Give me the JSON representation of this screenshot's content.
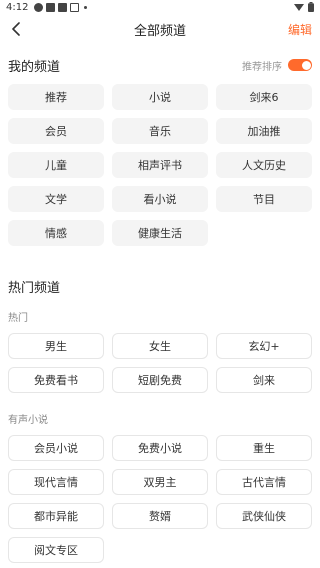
{
  "status": {
    "time": "4:12"
  },
  "header": {
    "title": "全部频道",
    "edit": "编辑"
  },
  "my_channels": {
    "title": "我的频道",
    "sort_label": "推荐排序",
    "sort_enabled": true,
    "items": [
      "推荐",
      "小说",
      "剑来6",
      "会员",
      "音乐",
      "加油推",
      "儿童",
      "相声评书",
      "人文历史",
      "文学",
      "看小说",
      "节目",
      "情感",
      "健康生活"
    ]
  },
  "hot_channels": {
    "title": "热门频道",
    "groups": [
      {
        "name": "热门",
        "items": [
          "男生",
          "女生",
          "玄幻+",
          "免费看书",
          "短剧免费",
          "剑来"
        ]
      },
      {
        "name": "有声小说",
        "items": [
          "会员小说",
          "免费小说",
          "重生",
          "现代言情",
          "双男主",
          "古代言情",
          "都市异能",
          "赘婿",
          "武侠仙侠",
          "阅文专区"
        ]
      }
    ]
  },
  "colors": {
    "accent": "#ff6a2c",
    "chip_bg": "#f4f4f4",
    "chip_border": "#e6e6e6"
  }
}
